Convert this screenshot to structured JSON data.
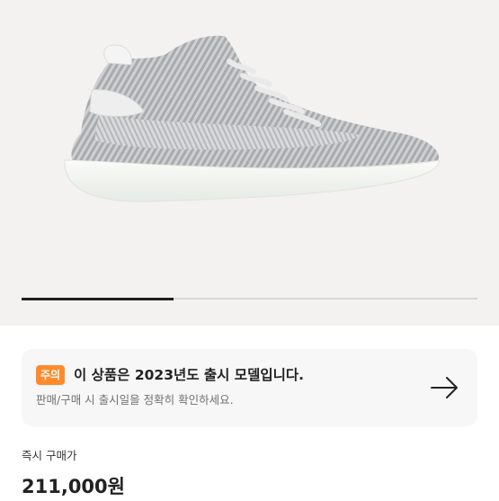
{
  "product": {
    "image_icon": "sneaker-image"
  },
  "gallery": {
    "current_page": 1,
    "total_pages": 3
  },
  "notice": {
    "badge": "주의",
    "title": "이 상품은 2023년도 출시 모델입니다.",
    "subtitle": "판매/구매 시 출시일을 정확히 확인하세요.",
    "action_icon": "arrow-right-icon"
  },
  "price": {
    "label": "즉시 구매가",
    "value": "211,000원"
  },
  "colors": {
    "badge": "#ff8a2b",
    "hero_background": "#f3f2f0",
    "notice_background": "#f7f7f7"
  }
}
